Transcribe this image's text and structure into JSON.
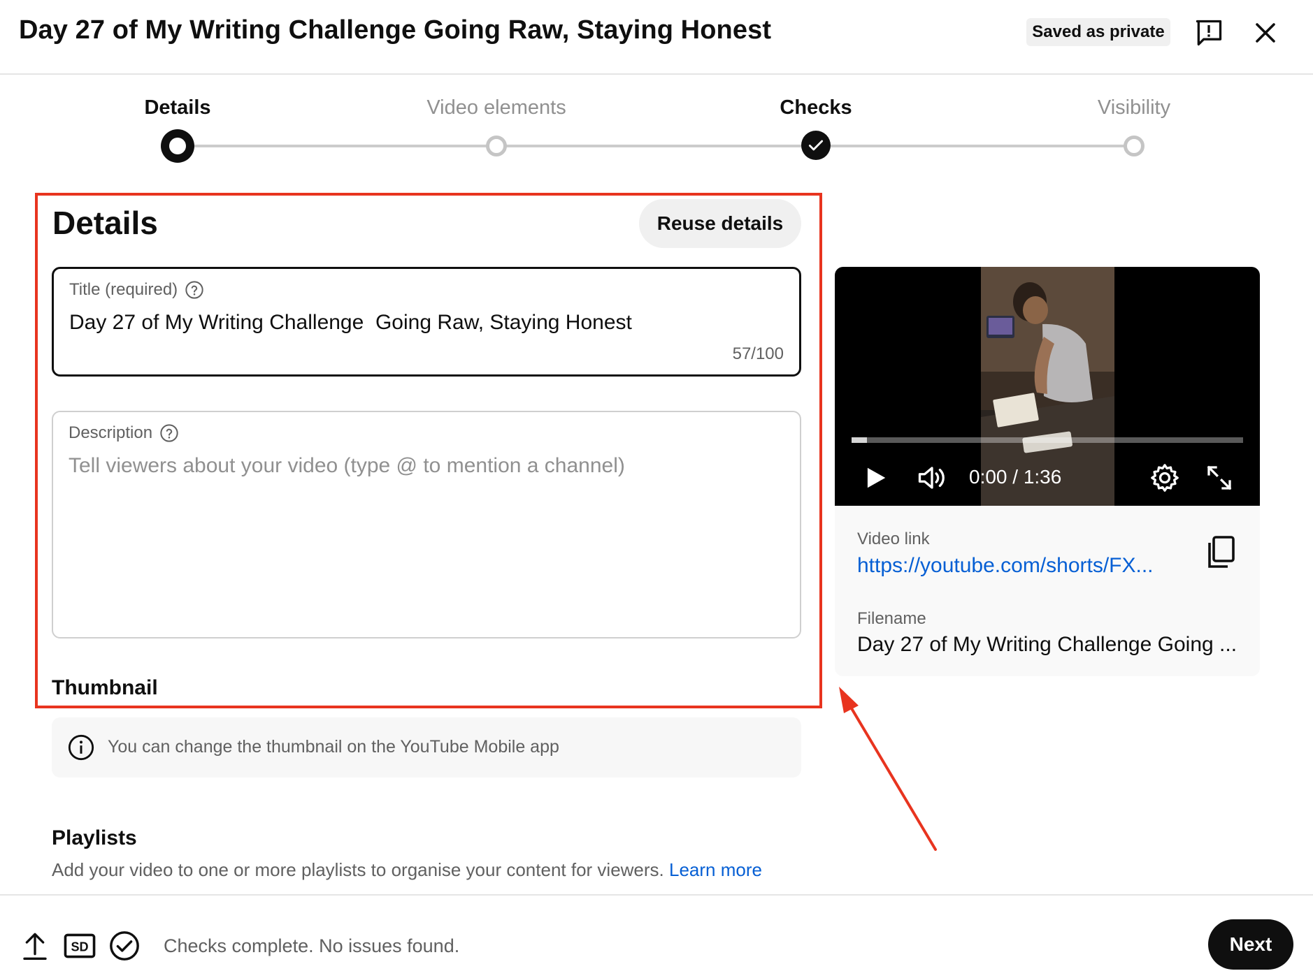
{
  "header": {
    "title": "Day 27 of My Writing Challenge Going Raw, Staying Honest",
    "saved_status": "Saved as private",
    "icons": [
      "feedback-icon",
      "close-icon"
    ]
  },
  "stepper": {
    "steps": [
      {
        "label": "Details",
        "state": "current"
      },
      {
        "label": "Video elements",
        "state": "pending"
      },
      {
        "label": "Checks",
        "state": "done"
      },
      {
        "label": "Visibility",
        "state": "pending"
      }
    ]
  },
  "details": {
    "heading": "Details",
    "reuse_label": "Reuse details",
    "title_field": {
      "label": "Title (required)",
      "value": "Day 27 of My Writing Challenge  Going Raw, Staying Honest",
      "count": "57/100"
    },
    "description_field": {
      "label": "Description",
      "placeholder": "Tell viewers about your video (type @ to mention a channel)"
    },
    "thumbnail": {
      "heading": "Thumbnail",
      "note": "You can change the thumbnail on the YouTube Mobile app"
    },
    "playlists": {
      "heading": "Playlists",
      "description": "Add your video to one or more playlists to organise your content for viewers.",
      "learn_more": "Learn more"
    }
  },
  "video": {
    "time": "0:00 / 1:36",
    "progress_fraction": 0.04,
    "link_label": "Video link",
    "link": "https://youtube.com/shorts/FX...",
    "filename_label": "Filename",
    "filename": "Day 27 of My Writing Challenge Going ..."
  },
  "footer": {
    "status": "Checks complete. No issues found.",
    "next_label": "Next",
    "icons": [
      "upload-icon",
      "sd-icon",
      "checks-complete-icon"
    ]
  },
  "colors": {
    "accent_link": "#065fd4",
    "annotation_red": "#e8341f",
    "primary_text": "#0f0f0f",
    "secondary_text": "#606060"
  }
}
